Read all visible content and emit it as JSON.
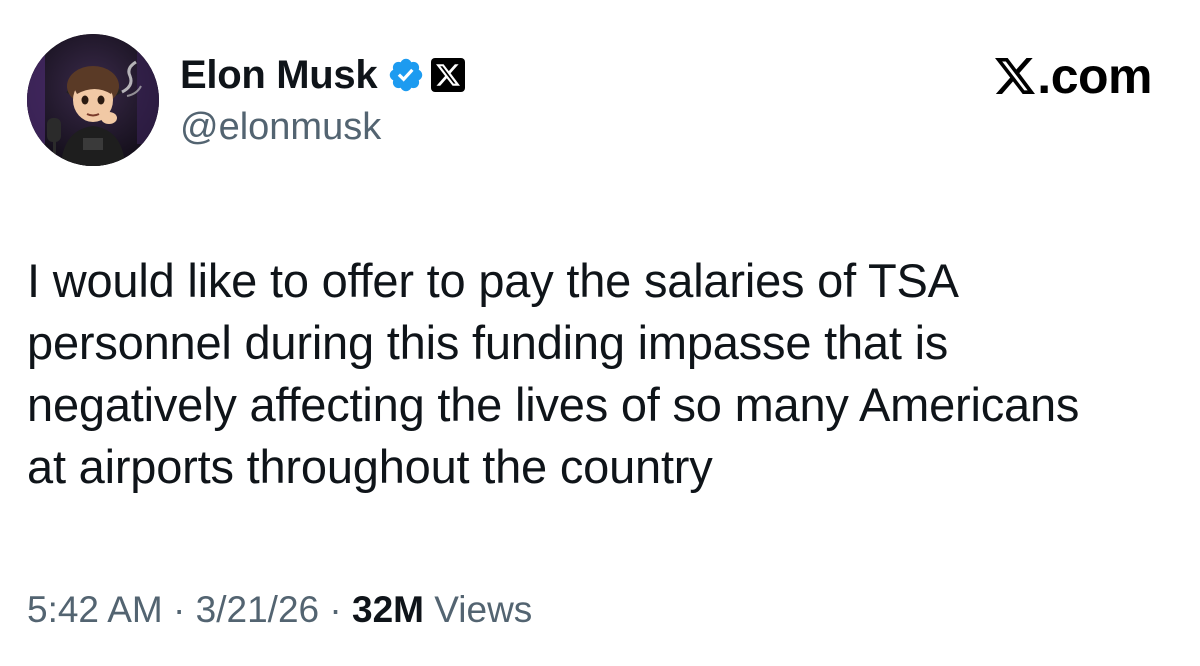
{
  "author": {
    "display_name": "Elon Musk",
    "handle": "@elonmusk",
    "verified": true,
    "affiliate_badge": "x-logo-icon",
    "avatar": "profile-avatar"
  },
  "site": {
    "wordmark_text": ".com",
    "logo_icon": "x-logo-icon"
  },
  "tweet": {
    "lines": [
      "I would like to offer to pay the salaries of TSA",
      "personnel during this funding impasse that is",
      "negatively affecting the lives of so many Americans",
      "at airports throughout the country"
    ]
  },
  "meta": {
    "time": "5:42 AM",
    "separator": "·",
    "date": "3/21/26",
    "views_count": "32M",
    "views_label": "Views"
  },
  "colors": {
    "text_primary": "#0f1419",
    "text_secondary": "#536471",
    "verified_blue": "#1d9bf0",
    "black": "#000000"
  }
}
